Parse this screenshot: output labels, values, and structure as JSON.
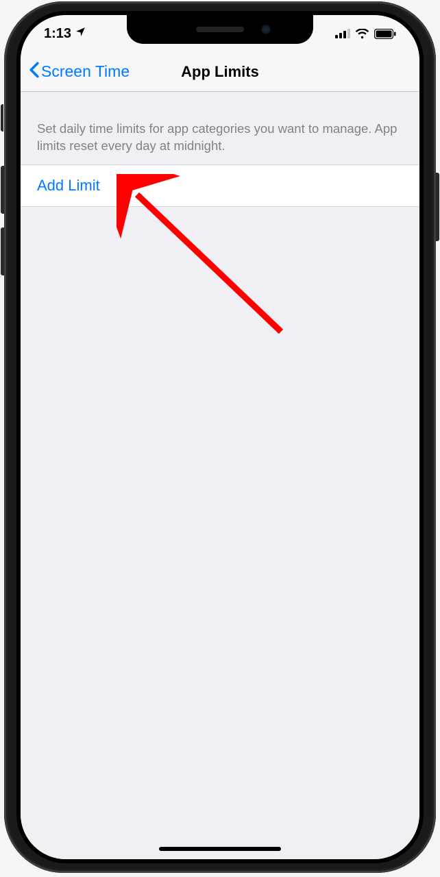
{
  "status_bar": {
    "time": "1:13"
  },
  "nav": {
    "back_label": "Screen Time",
    "title": "App Limits"
  },
  "content": {
    "description": "Set daily time limits for app categories you want to manage. App limits reset every day at midnight.",
    "add_limit_label": "Add Limit"
  },
  "colors": {
    "ios_blue": "#007aff",
    "settings_bg": "#efeff4",
    "annotation_red": "#ff0000"
  }
}
